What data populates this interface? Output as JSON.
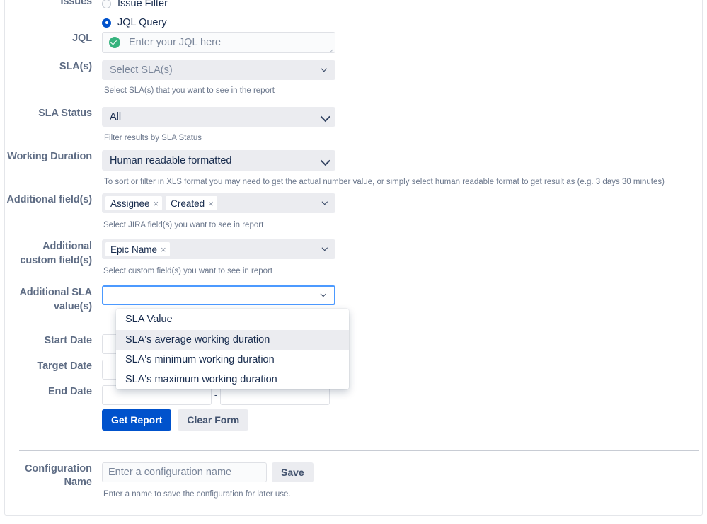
{
  "form": {
    "issues": {
      "label": "Issues",
      "options": [
        {
          "label": "Issue Filter",
          "selected": false
        },
        {
          "label": "JQL Query",
          "selected": true
        }
      ]
    },
    "jql": {
      "label": "JQL",
      "placeholder": "Enter your JQL here",
      "value": "",
      "status_icon": "check-circle-icon"
    },
    "slas": {
      "label": "SLA(s)",
      "value": "Select SLA(s)",
      "is_placeholder": true,
      "help": "Select SLA(s) that you want to see in the report"
    },
    "sla_status": {
      "label": "SLA Status",
      "value": "All",
      "help": "Filter results by SLA Status"
    },
    "working_duration": {
      "label": "Working Duration",
      "value": "Human readable formatted",
      "help": "To sort or filter in XLS format you may need to get the actual number value, or simply select human readable format to get result as (e.g. 3 days 30 minutes)"
    },
    "additional_fields": {
      "label": "Additional field(s)",
      "tags": [
        "Assignee",
        "Created"
      ],
      "help": "Select JIRA field(s) you want to see in report"
    },
    "additional_custom_fields": {
      "label": "Additional custom field(s)",
      "tags": [
        "Epic Name"
      ],
      "help": "Select custom field(s) you want to see in report"
    },
    "additional_sla_values": {
      "label": "Additional SLA value(s)",
      "value": "",
      "focused": true,
      "dropdown_open": true,
      "options": [
        {
          "label": "SLA Value",
          "highlighted": false
        },
        {
          "label": "SLA's average working duration",
          "highlighted": true
        },
        {
          "label": "SLA's minimum working duration",
          "highlighted": false
        },
        {
          "label": "SLA's maximum working duration",
          "highlighted": false
        }
      ]
    },
    "start_date": {
      "label": "Start Date",
      "from": "",
      "to": "",
      "separator": "-"
    },
    "target_date": {
      "label": "Target Date",
      "from": "",
      "to": "",
      "separator": "-"
    },
    "end_date": {
      "label": "End Date",
      "from": "",
      "to": "",
      "separator": "-"
    },
    "actions": {
      "get_report": "Get Report",
      "clear_form": "Clear Form"
    },
    "configuration": {
      "label_line1": "Configuration",
      "label_line2": "Name",
      "placeholder": "Enter a configuration name",
      "value": "",
      "save_label": "Save",
      "help": "Enter a name to save the configuration for later use."
    }
  },
  "colors": {
    "primary": "#0052cc",
    "focus_border": "#4c9aff",
    "label_text": "#5e6c84",
    "body_text": "#172b4d",
    "help_text": "#6b778c",
    "field_bg": "#ebecf0",
    "success": "#36b37e"
  }
}
